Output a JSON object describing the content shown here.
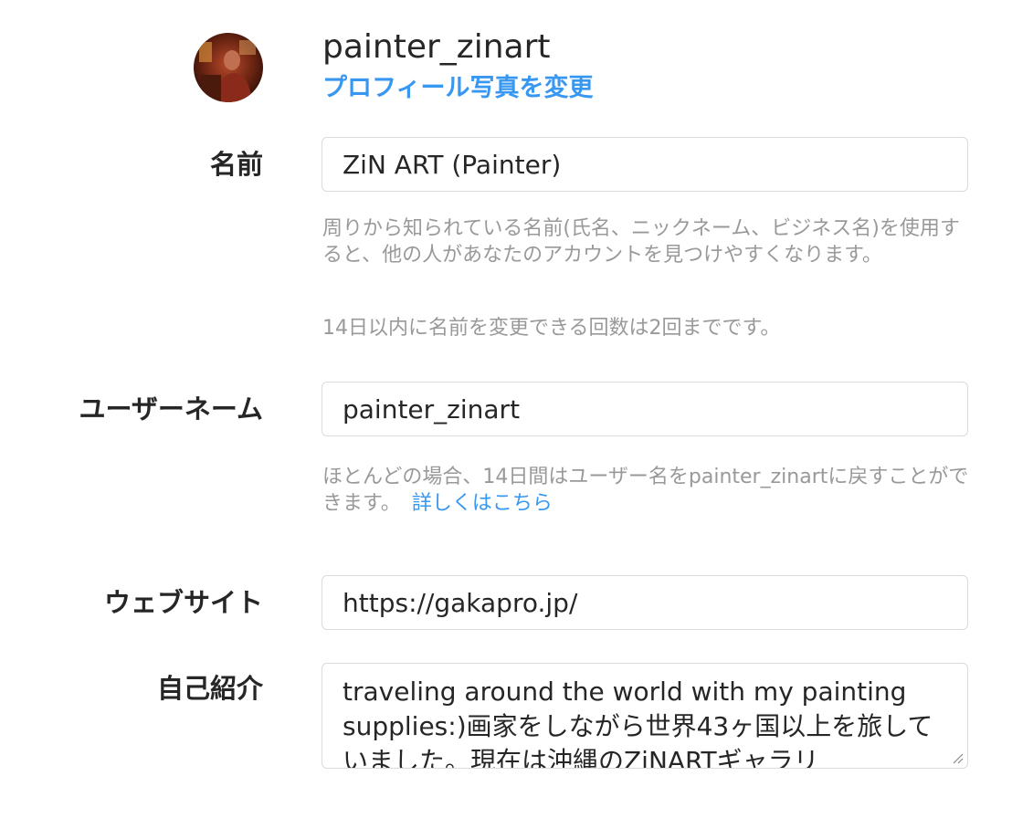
{
  "profile": {
    "username": "painter_zinart",
    "change_photo_label": "プロフィール写真を変更"
  },
  "fields": {
    "name": {
      "label": "名前",
      "value": "ZiN ART (Painter)",
      "help1": "周りから知られている名前(氏名、ニックネーム、ビジネス名)を使用すると、他の人があなたのアカウントを見つけやすくなります。",
      "help2": "14日以内に名前を変更できる回数は2回までです。"
    },
    "username": {
      "label": "ユーザーネーム",
      "value": "painter_zinart",
      "help": "ほとんどの場合、14日間はユーザー名をpainter_zinartに戻すことができます。",
      "help_link": "詳しくはこちら"
    },
    "website": {
      "label": "ウェブサイト",
      "value": "https://gakapro.jp/"
    },
    "bio": {
      "label": "自己紹介",
      "value": "traveling around the world with my painting supplies:)画家をしながら世界43ヶ国以上を旅していました。現在は沖縄のZiNARTギャラリ"
    }
  },
  "colors": {
    "accent": "#3897f0",
    "text": "#262626",
    "muted": "#999999",
    "border": "#dbdbdb"
  }
}
